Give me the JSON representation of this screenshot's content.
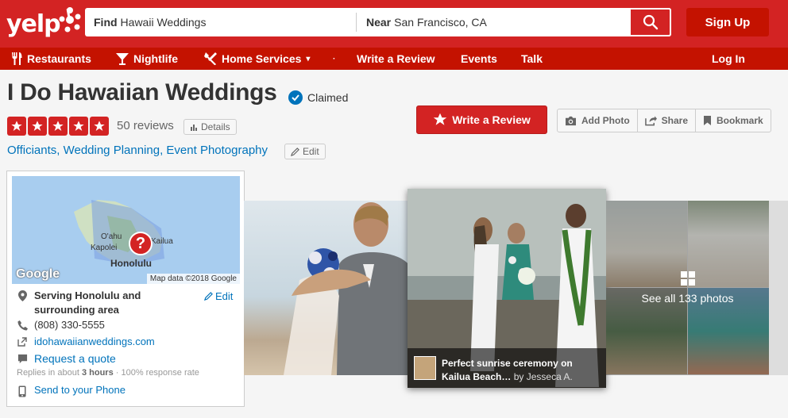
{
  "header": {
    "logo": "yelp",
    "search": {
      "find_label": "Find",
      "find_value": "Hawaii Weddings",
      "near_label": "Near",
      "near_value": "San Francisco, CA"
    },
    "signup": "Sign Up"
  },
  "nav": {
    "items": [
      {
        "label": "Restaurants",
        "icon": "fork-knife-icon"
      },
      {
        "label": "Nightlife",
        "icon": "cocktail-icon"
      },
      {
        "label": "Home Services",
        "icon": "tools-icon",
        "dropdown": "▾"
      },
      {
        "label": "Write a Review"
      },
      {
        "label": "Events"
      },
      {
        "label": "Talk"
      }
    ],
    "login": "Log In"
  },
  "business": {
    "name": "I Do Hawaiian Weddings",
    "claimed": "Claimed",
    "rating": 5,
    "reviews": "50 reviews",
    "details": "Details",
    "categories": [
      "Officiants",
      "Wedding Planning",
      "Event Photography"
    ],
    "edit": "Edit"
  },
  "actions": {
    "write_review": "Write a Review",
    "add_photo": "Add Photo",
    "share": "Share",
    "bookmark": "Bookmark"
  },
  "map": {
    "credit": "Map data ©2018 Google",
    "google": "Google",
    "labels": [
      "O'ahu",
      "Kapolei",
      "Kailua",
      "Honolulu"
    ]
  },
  "info": {
    "serving": "Serving Honolulu and surrounding area",
    "edit": "Edit",
    "phone": "(808) 330-5555",
    "website": "idohawaiianweddings.com",
    "request_quote": "Request a quote",
    "replies_prefix": "Replies in about ",
    "replies_time": "3 hours",
    "replies_suffix": " · 100% response rate",
    "send_phone": "Send to your Phone"
  },
  "photos": {
    "featured_caption": "Perfect sunrise ceremony on Kailua Beach…",
    "featured_by": "by Jesseca A.",
    "see_all": "See all 133 photos"
  },
  "colors": {
    "brand_red": "#d32323",
    "nav_red": "#c41200",
    "link_blue": "#0073bb"
  }
}
